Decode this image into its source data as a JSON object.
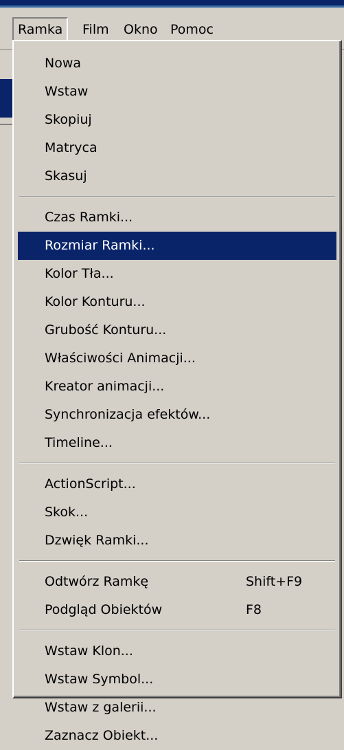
{
  "menubar": {
    "items": [
      {
        "label": "Ramka",
        "active": true
      },
      {
        "label": "Film",
        "active": false
      },
      {
        "label": "Okno",
        "active": false
      },
      {
        "label": "Pomoc",
        "active": false
      }
    ]
  },
  "dropdown": {
    "groups": [
      [
        {
          "label": "Nowa"
        },
        {
          "label": "Wstaw"
        },
        {
          "label": "Skopiuj"
        },
        {
          "label": "Matryca"
        },
        {
          "label": "Skasuj"
        }
      ],
      [
        {
          "label": "Czas Ramki..."
        },
        {
          "label": "Rozmiar Ramki...",
          "selected": true
        },
        {
          "label": "Kolor Tła..."
        },
        {
          "label": "Kolor Konturu..."
        },
        {
          "label": "Grubość Konturu..."
        },
        {
          "label": "Właściwości Animacji..."
        },
        {
          "label": "Kreator animacji..."
        },
        {
          "label": "Synchronizacja efektów..."
        },
        {
          "label": "Timeline..."
        }
      ],
      [
        {
          "label": "ActionScript..."
        },
        {
          "label": "Skok..."
        },
        {
          "label": "Dzwięk Ramki..."
        }
      ],
      [
        {
          "label": "Odtwórz Ramkę",
          "shortcut": "Shift+F9"
        },
        {
          "label": "Podgląd Obiektów",
          "shortcut": "F8"
        }
      ],
      [
        {
          "label": "Wstaw Klon..."
        },
        {
          "label": "Wstaw Symbol..."
        },
        {
          "label": "Wstaw z galerii..."
        },
        {
          "label": "Zaznacz Obiekt..."
        }
      ]
    ]
  },
  "colors": {
    "face": "#d4d0c8",
    "highlight": "#0a246a",
    "highlight_text": "#ffffff"
  }
}
